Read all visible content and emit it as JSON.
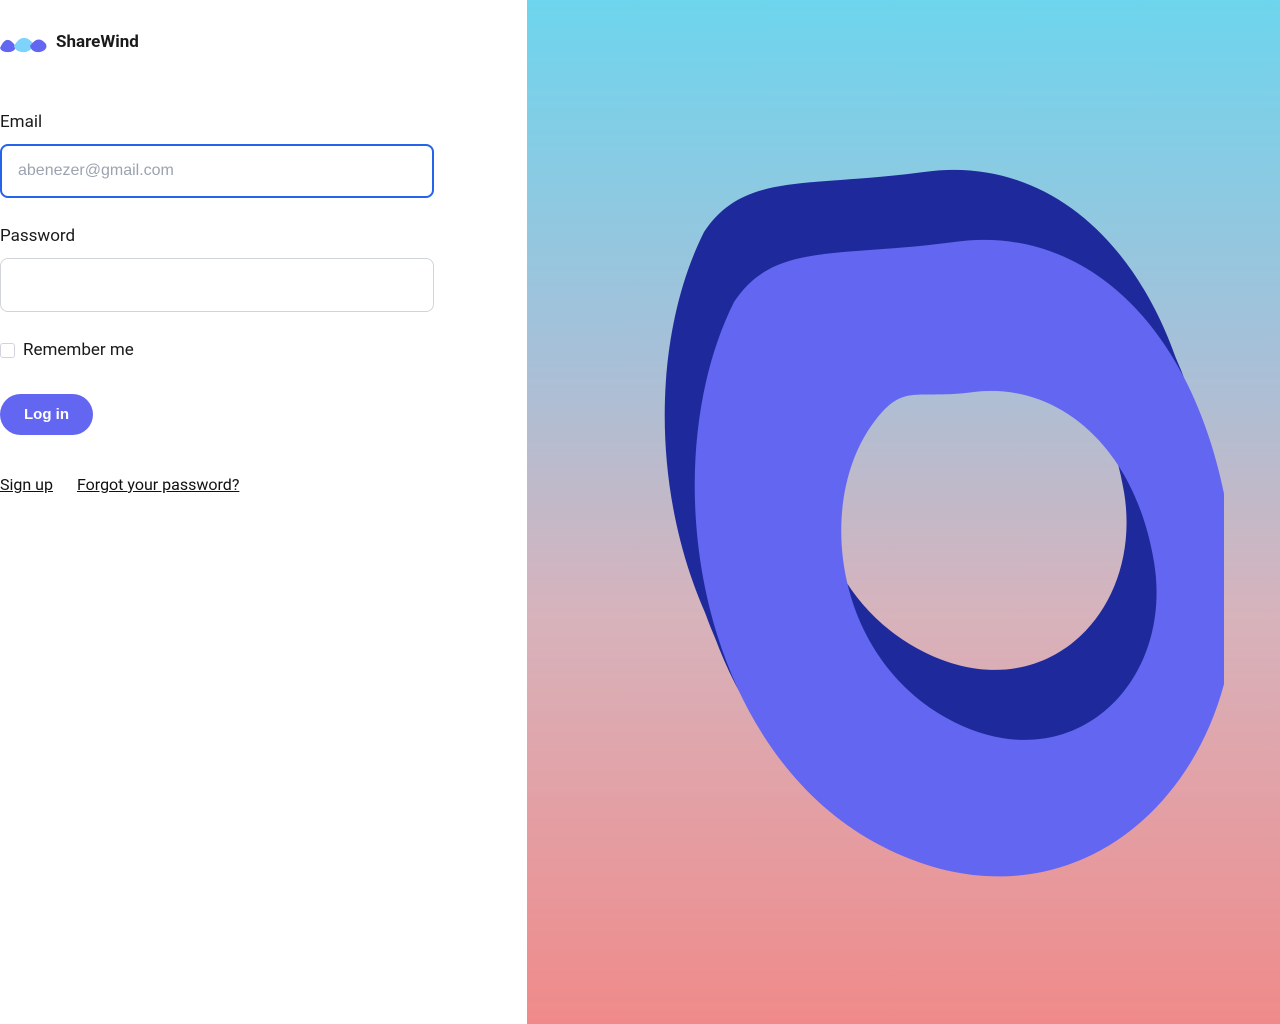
{
  "brand": {
    "name": "ShareWind"
  },
  "form": {
    "email_label": "Email",
    "email_placeholder": "abenezer@gmail.com",
    "email_value": "",
    "password_label": "Password",
    "password_value": "",
    "remember_label": "Remember me",
    "submit_label": "Log in"
  },
  "links": {
    "signup": "Sign up",
    "forgot": "Forgot your password?"
  },
  "colors": {
    "accent": "#6366f1",
    "focus_border": "#2563eb",
    "blob_light": "#6366f1",
    "blob_dark": "#1e2a9c"
  }
}
